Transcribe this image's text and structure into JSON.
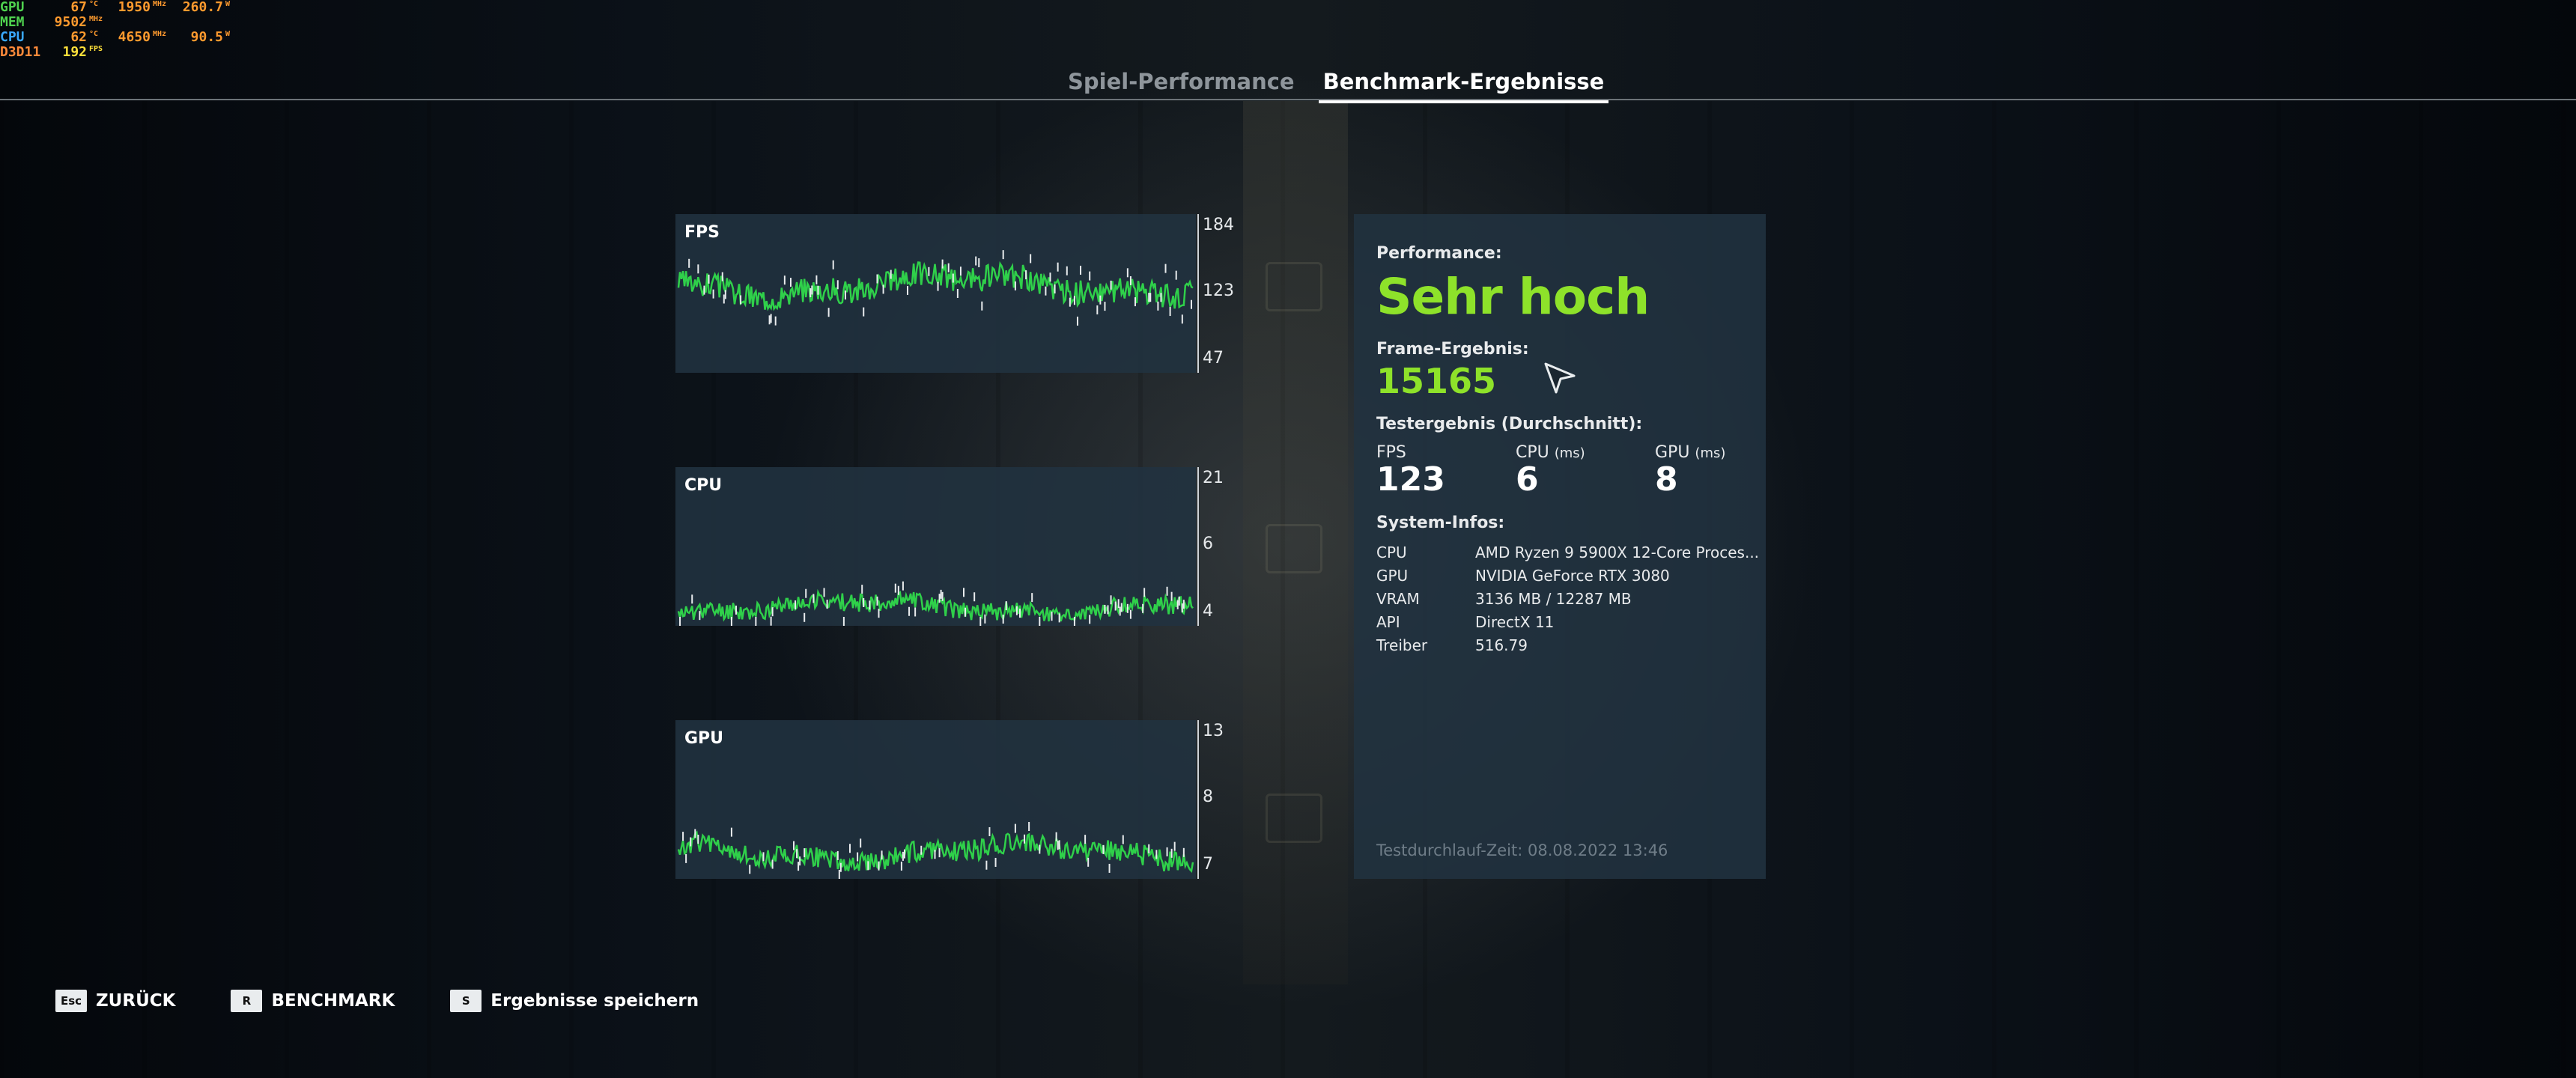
{
  "hud": {
    "rows": [
      {
        "label": "GPU",
        "v1": "67",
        "u1": "°C",
        "v2": "1950",
        "u2": "MHz",
        "v3": "260.7",
        "u3": "W",
        "color_label": "#4fd24f"
      },
      {
        "label": "MEM",
        "v1": "9502",
        "u1": "MHz",
        "v2": "",
        "u2": "",
        "v3": "",
        "u3": "",
        "color_label": "#4fd24f"
      },
      {
        "label": "CPU",
        "v1": "62",
        "u1": "°C",
        "v2": "4650",
        "u2": "MHz",
        "v3": "90.5",
        "u3": "W",
        "color_label": "#3aa8ff"
      },
      {
        "label": "D3D11",
        "v1": "192",
        "u1": "FPS",
        "v2": "",
        "u2": "",
        "v3": "",
        "u3": "",
        "color_label": "#ff8a3a"
      }
    ],
    "value_color": "#ff9a2e",
    "fps_color": "#ffe03a"
  },
  "tabs": [
    {
      "label": "Spiel-Performance",
      "active": false
    },
    {
      "label": "Benchmark-Ergebnisse",
      "active": true
    }
  ],
  "graphs": [
    {
      "title": "FPS",
      "y_top": "184",
      "y_mid": "123",
      "y_bot": "47",
      "min": 47,
      "max": 184,
      "base": 123,
      "amp": 14,
      "seed": 3
    },
    {
      "title": "CPU",
      "y_top": "21",
      "y_mid": "6",
      "y_bot": "4",
      "min": 4,
      "max": 21,
      "base": 6,
      "amp": 1.2,
      "seed": 11
    },
    {
      "title": "GPU",
      "y_top": "13",
      "y_mid": "8",
      "y_bot": "7",
      "min": 7,
      "max": 13,
      "base": 8,
      "amp": 0.5,
      "seed": 27
    }
  ],
  "panel": {
    "performance_label": "Performance:",
    "performance_value": "Sehr hoch",
    "frame_label": "Frame-Ergebnis:",
    "frame_value": "15165",
    "test_label": "Testergebnis (Durchschnitt):",
    "stats": [
      {
        "label": "FPS",
        "unit": "",
        "value": "123"
      },
      {
        "label": "CPU",
        "unit": "(ms)",
        "value": "6"
      },
      {
        "label": "GPU",
        "unit": "(ms)",
        "value": "8"
      }
    ],
    "sys_label": "System-Infos:",
    "sys": [
      {
        "k": "CPU",
        "v": "AMD Ryzen 9 5900X 12-Core Proces..."
      },
      {
        "k": "GPU",
        "v": "NVIDIA GeForce RTX 3080"
      },
      {
        "k": "VRAM",
        "v": "3136 MB / 12287 MB"
      },
      {
        "k": "API",
        "v": "DirectX 11"
      },
      {
        "k": "Treiber",
        "v": "516.79"
      }
    ],
    "time": "Testdurchlauf-Zeit: 08.08.2022 13:46"
  },
  "keys": [
    {
      "cap": "Esc",
      "label": "ZURÜCK"
    },
    {
      "cap": "R",
      "label": "BENCHMARK"
    },
    {
      "cap": "S",
      "label": "Ergebnisse speichern"
    }
  ],
  "colors": {
    "accent_green": "#8ee22a",
    "graph_line": "#2fd04a",
    "panel_bg": "#213240"
  }
}
